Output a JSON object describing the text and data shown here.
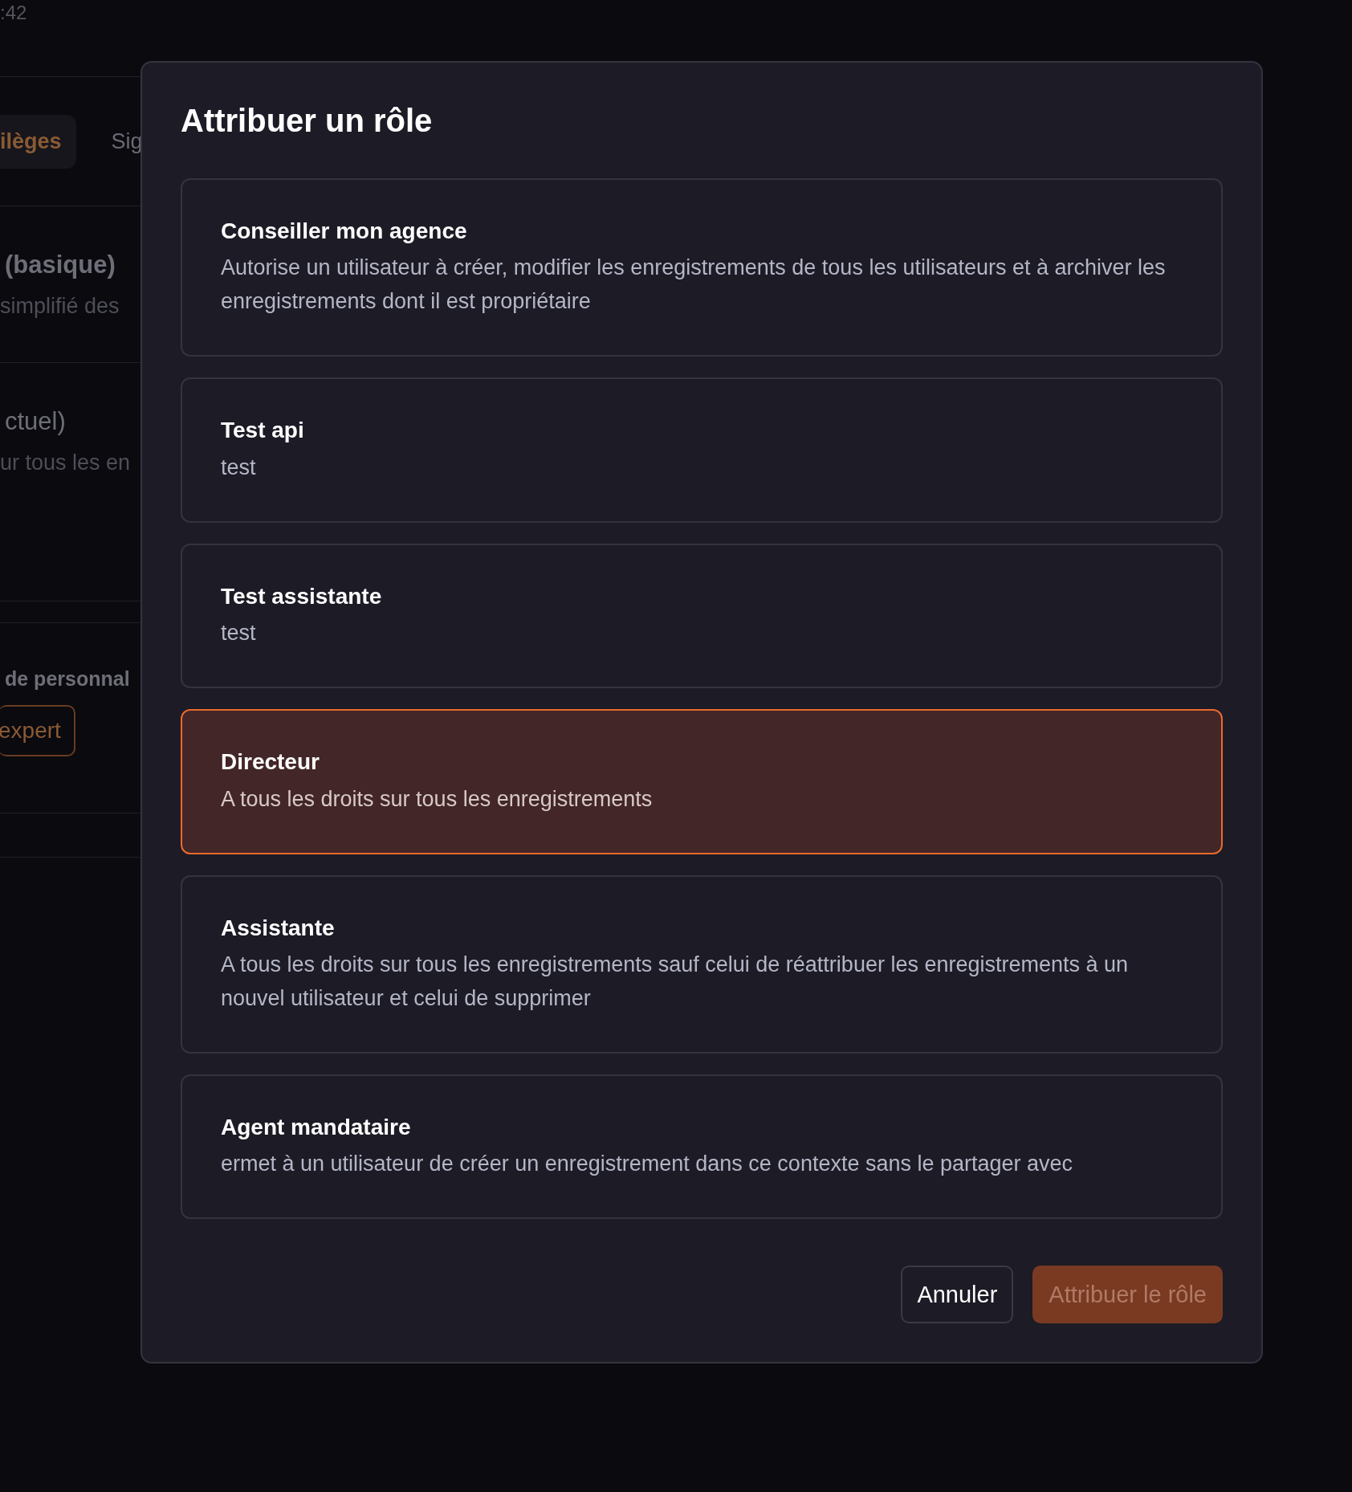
{
  "background": {
    "time": ":42",
    "tabs": [
      {
        "label": "ilèges",
        "selected": true
      },
      {
        "label": "Sig",
        "selected": false
      }
    ],
    "sections": [
      {
        "title": "(basique)",
        "text": "simplifié des"
      },
      {
        "title": "ctuel)",
        "text": "ur tous les en"
      }
    ],
    "settings": {
      "title": "de personnal",
      "button": "expert"
    }
  },
  "dialog": {
    "title": "Attribuer un rôle",
    "roles": [
      {
        "name": "Conseiller mon agence",
        "description": "Autorise un utilisateur à créer, modifier les enregistrements de tous les utilisateurs et à archiver les enregistrements dont il est propriétaire",
        "selected": false
      },
      {
        "name": "Test api",
        "description": "test",
        "selected": false
      },
      {
        "name": "Test assistante",
        "description": "test",
        "selected": false
      },
      {
        "name": "Directeur",
        "description": "A tous les droits sur tous les enregistrements",
        "selected": true
      },
      {
        "name": "Assistante",
        "description": "A tous les droits sur tous les enregistrements sauf celui de réattribuer les enregistrements à un nouvel utilisateur et celui de supprimer",
        "selected": false
      },
      {
        "name": "Agent mandataire",
        "description": "ermet à un utilisateur de créer un enregistrement dans ce contexte sans le partager avec",
        "selected": false
      }
    ],
    "buttons": [
      {
        "label": "Annuler",
        "kind": "secondary",
        "disabled": false
      },
      {
        "label": "Attribuer le rôle",
        "kind": "primary",
        "disabled": true
      }
    ]
  }
}
